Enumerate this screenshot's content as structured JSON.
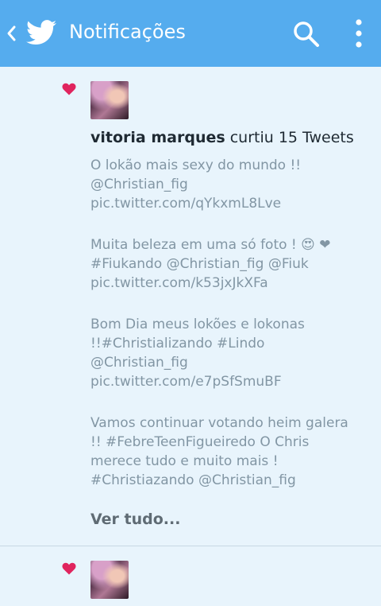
{
  "appbar": {
    "title": "Notificações",
    "back_icon": "chevron-left-icon",
    "logo_icon": "twitter-bird-icon",
    "search_icon": "search-icon",
    "menu_icon": "more-vert-icon",
    "color": "#55acee"
  },
  "notifications": [
    {
      "user": "vitoria marques",
      "action": " curtiu 15 Tweets",
      "heart_color": "#e0245e",
      "tweets": [
        "O lokão mais sexy do mundo !! @Christian_fig pic.twitter.com/qYkxmL8Lve",
        "Muita beleza em uma só foto ! 😍 ❤ #Fiukando @Christian_fig @Fiuk pic.twitter.com/k53jxJkXFa",
        "Bom Dia meus lokões e lokonas !!#Christializando #Lindo @Christian_fig pic.twitter.com/e7pSfSmuBF",
        "Vamos continuar votando heim galera !! #FebreTeenFigueiredo O Chris merece tudo e muito mais ! #Christiazando @Christian_fig"
      ],
      "see_all": "Ver tudo..."
    },
    {
      "heart_color": "#e0245e"
    }
  ]
}
